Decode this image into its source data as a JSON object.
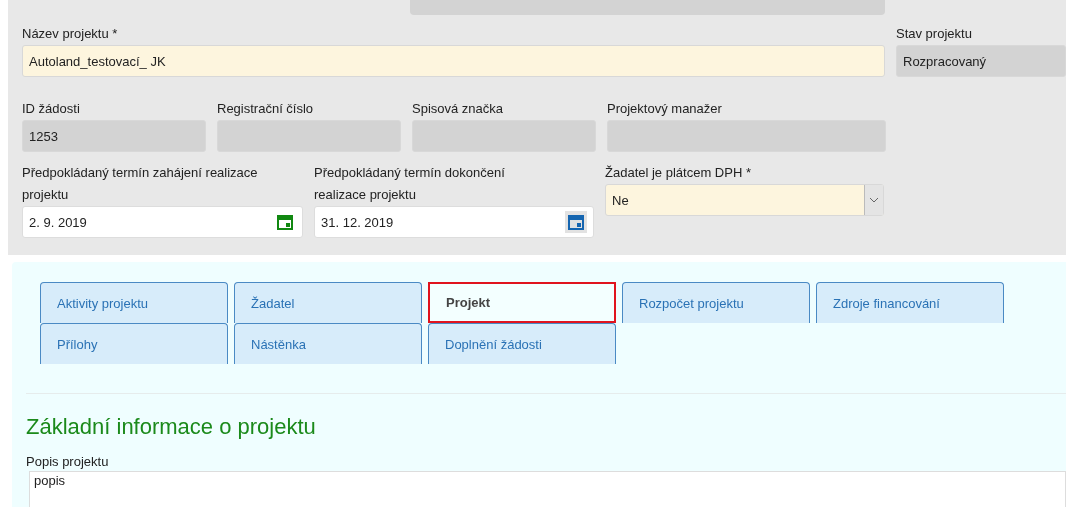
{
  "project_name": {
    "label": "Název projektu *",
    "value": "Autoland_testovací_ JK"
  },
  "status": {
    "label": "Stav projektu",
    "value": "Rozpracovaný"
  },
  "info_fields": [
    {
      "label": "ID žádosti",
      "value": "1253"
    },
    {
      "label": "Registrační číslo"
    },
    {
      "label": "Spisová značka"
    },
    {
      "label": "Projektový manažer"
    }
  ],
  "dates": [
    {
      "label": "Předpokládaný termín zahájení realizace projektu",
      "value": "2. 9. 2019",
      "color": "#118811"
    },
    {
      "label": "Předpokládaný termín dokončení realizace projektu",
      "value": "31. 12. 2019",
      "color": "#1565b0"
    }
  ],
  "vat_select": {
    "label": "Žadatel je plátcem DPH *",
    "value": "Ne"
  },
  "tab_rows": [
    [
      {
        "label": "Aktivity projektu",
        "selected": false,
        "highlighted": false
      },
      {
        "label": "Žadatel",
        "selected": false,
        "highlighted": false
      },
      {
        "label": "Projekt",
        "selected": true,
        "highlighted": true
      },
      {
        "label": "Rozpočet projektu",
        "selected": false,
        "highlighted": false
      },
      {
        "label": "Zdroje financování",
        "selected": false,
        "highlighted": false
      }
    ],
    [
      {
        "label": "Přílohy",
        "selected": false,
        "highlighted": false
      },
      {
        "label": "Nástěnka",
        "selected": false,
        "highlighted": false
      },
      {
        "label": "Doplnění žádosti",
        "selected": false,
        "highlighted": false
      }
    ]
  ],
  "section": {
    "title": "Základní informace o projektu",
    "description_label": "Popis projektu",
    "description": "popis"
  }
}
